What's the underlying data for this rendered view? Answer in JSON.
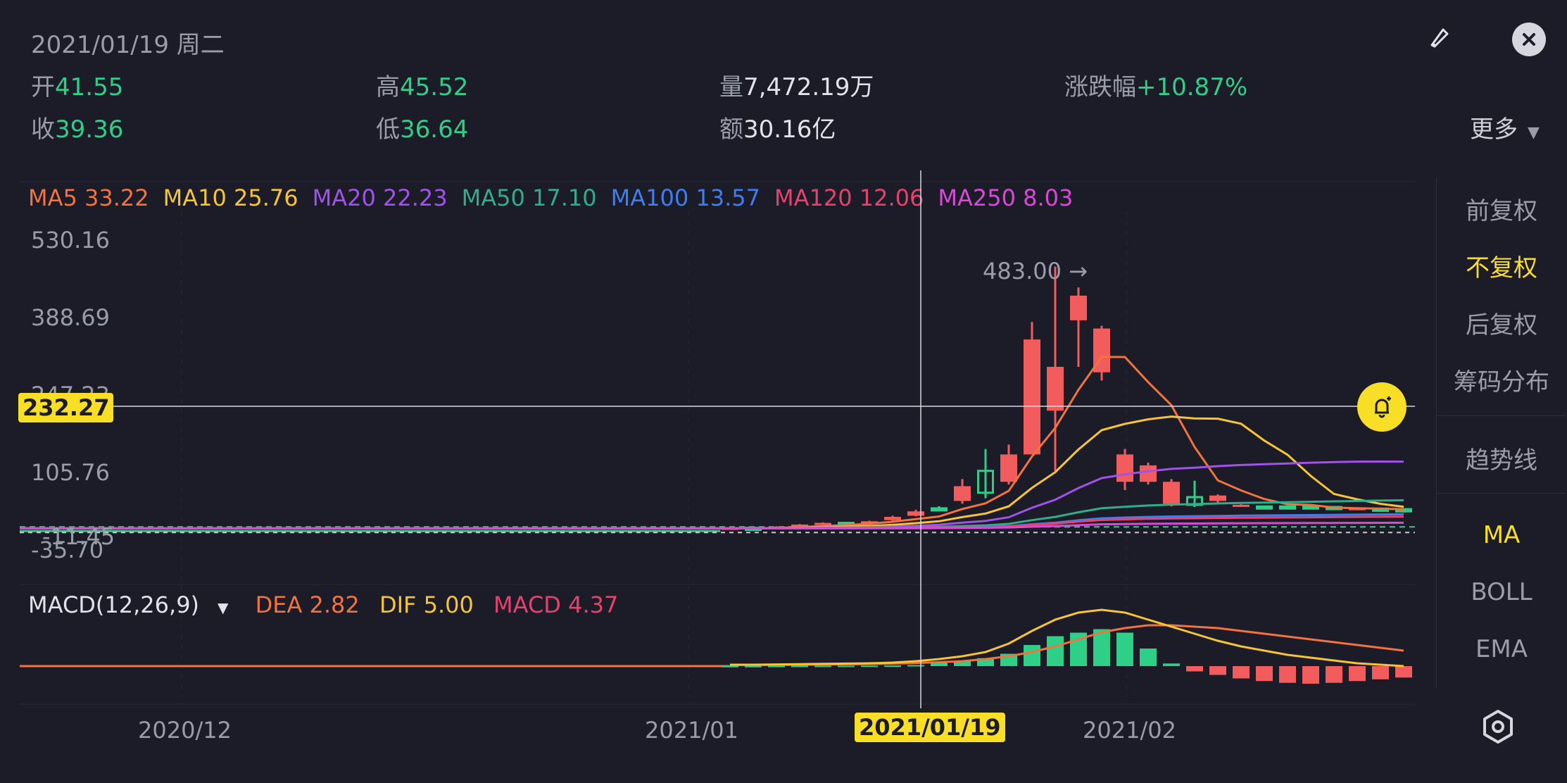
{
  "header": {
    "date": "2021/01/19 周二",
    "open_label": "开",
    "open_value": "41.55",
    "high_label": "高",
    "high_value": "45.52",
    "volume_label": "量",
    "volume_value": "7,472.19万",
    "change_label": "涨跌幅",
    "change_value": "+10.87%",
    "close_label": "收",
    "close_value": "39.36",
    "low_label": "低",
    "low_value": "36.64",
    "amount_label": "额",
    "amount_value": "30.16亿"
  },
  "ma": [
    {
      "text": "MA5 33.22",
      "color": "#f2733c"
    },
    {
      "text": "MA10 25.76",
      "color": "#f7c534"
    },
    {
      "text": "MA20 22.23",
      "color": "#a153e8"
    },
    {
      "text": "MA50 17.10",
      "color": "#2fae8c"
    },
    {
      "text": "MA100 13.57",
      "color": "#3f7df0"
    },
    {
      "text": "MA120 12.06",
      "color": "#e8416b"
    },
    {
      "text": "MA250 8.03",
      "color": "#d949d8"
    }
  ],
  "y_axis": [
    "530.16",
    "388.69",
    "247.23",
    "105.76",
    "-11.45",
    "-35.70"
  ],
  "crosshair_price": "232.27",
  "max_annotation": "483.00",
  "macd": {
    "title": "MACD(12,26,9)",
    "dea": "DEA 2.82",
    "dif": "DIF 5.00",
    "macd": "MACD 4.37",
    "dea_color": "#f2733c",
    "dif_color": "#f7c534",
    "macd_color": "#e8416b"
  },
  "x_axis": [
    "2020/12",
    "2021/01",
    "2021/02"
  ],
  "crosshair_date": "2021/01/19",
  "more_label": "更多",
  "side_menu": {
    "qfq": "前复权",
    "bfq": "不复权",
    "hfq": "后复权",
    "chip": "筹码分布",
    "trend": "趋势线",
    "ma": "MA",
    "boll": "BOLL",
    "ema": "EMA"
  },
  "colors": {
    "up": "#f25c5c",
    "down": "#2ecf86",
    "accent": "#f9de26",
    "bg": "#1b1c27"
  },
  "chart_data": {
    "type": "candlestick",
    "ylim": [
      -35.7,
      530.16
    ],
    "candles": [
      {
        "o": 5,
        "c": 6,
        "h": 7,
        "l": 4
      },
      {
        "o": 6,
        "c": 5,
        "h": 7,
        "l": 4
      },
      {
        "o": 6,
        "c": 8,
        "h": 9,
        "l": 5
      },
      {
        "o": 9,
        "c": 12,
        "h": 13,
        "l": 8
      },
      {
        "o": 12,
        "c": 15,
        "h": 16,
        "l": 11
      },
      {
        "o": 15,
        "c": 14,
        "h": 17,
        "l": 13
      },
      {
        "o": 14,
        "c": 18,
        "h": 19,
        "l": 13
      },
      {
        "o": 20,
        "c": 26,
        "h": 28,
        "l": 19
      },
      {
        "o": 28,
        "c": 36,
        "h": 39,
        "l": 27
      },
      {
        "o": 41.55,
        "c": 39.36,
        "h": 45.52,
        "l": 36.64
      },
      {
        "o": 55,
        "c": 82,
        "h": 95,
        "l": 50
      },
      {
        "o": 110,
        "c": 70,
        "h": 150,
        "l": 60
      },
      {
        "o": 90,
        "c": 140,
        "h": 158,
        "l": 85
      },
      {
        "o": 140,
        "c": 350,
        "h": 382,
        "l": 250
      },
      {
        "o": 220,
        "c": 300,
        "h": 483,
        "l": 110
      },
      {
        "o": 385,
        "c": 430,
        "h": 445,
        "l": 300
      },
      {
        "o": 290,
        "c": 370,
        "h": 375,
        "l": 275
      },
      {
        "o": 90,
        "c": 140,
        "h": 150,
        "l": 75
      },
      {
        "o": 90,
        "c": 120,
        "h": 125,
        "l": 85
      },
      {
        "o": 50,
        "c": 90,
        "h": 95,
        "l": 45
      },
      {
        "o": 62,
        "c": 48,
        "h": 92,
        "l": 44
      },
      {
        "o": 55,
        "c": 65,
        "h": 67,
        "l": 52
      },
      {
        "o": 47,
        "c": 48,
        "h": 49,
        "l": 44
      },
      {
        "o": 45,
        "c": 42,
        "h": 46,
        "l": 40
      },
      {
        "o": 45,
        "c": 42,
        "h": 46,
        "l": 40
      },
      {
        "o": 45,
        "c": 42,
        "h": 46,
        "l": 40
      },
      {
        "o": 44,
        "c": 41,
        "h": 45,
        "l": 39
      },
      {
        "o": 41,
        "c": 42,
        "h": 43,
        "l": 38
      },
      {
        "o": 41,
        "c": 38,
        "h": 42,
        "l": 36
      },
      {
        "o": 40,
        "c": 36,
        "h": 41,
        "l": 34
      }
    ],
    "macd_hist": [
      0.2,
      0.2,
      0.3,
      0.4,
      0.5,
      0.5,
      0.6,
      0.8,
      1.2,
      4.37,
      6,
      9,
      14,
      24,
      34,
      38,
      42,
      38,
      20,
      3,
      -6,
      -10,
      -14,
      -17,
      -19,
      -20,
      -19,
      -17,
      -15,
      -13
    ],
    "dif": [
      1,
      1,
      1.2,
      1.4,
      1.6,
      1.8,
      2,
      2.5,
      3.5,
      5.0,
      7,
      10,
      16,
      25,
      33,
      38,
      40,
      38,
      33,
      28,
      23,
      18,
      14,
      11,
      8,
      6,
      4,
      2,
      1,
      0
    ],
    "dea": [
      0.8,
      0.8,
      0.9,
      1.0,
      1.1,
      1.3,
      1.5,
      1.8,
      2.2,
      2.82,
      3.5,
      5,
      7,
      10,
      14,
      19,
      24,
      27,
      29,
      29,
      28,
      27,
      25,
      23,
      21,
      19,
      17,
      15,
      13,
      11
    ]
  }
}
